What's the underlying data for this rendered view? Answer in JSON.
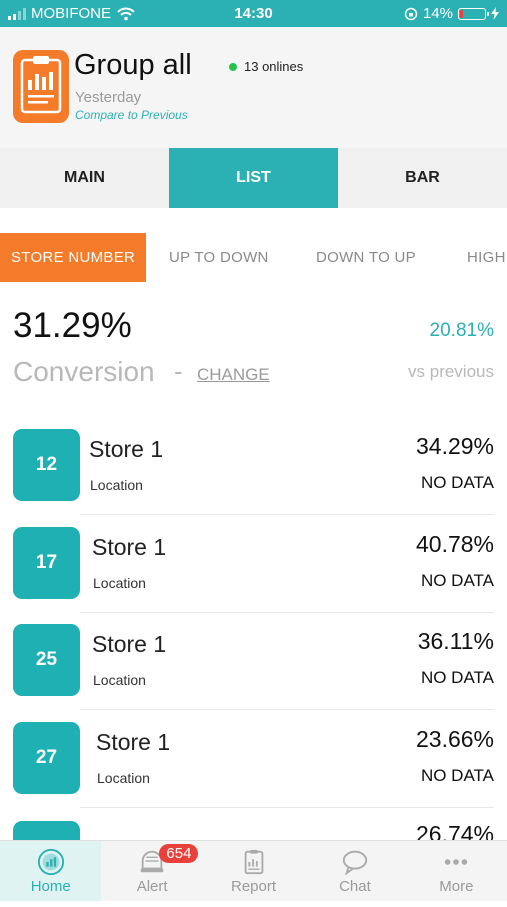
{
  "status_bar": {
    "carrier": "MOBIFONE",
    "time": "14:30",
    "battery": "14%",
    "battery_level": 0.14
  },
  "header": {
    "title": "Group all",
    "online_count": "13 onlines",
    "period": "Yesterday",
    "compare_link": "Compare to Previous"
  },
  "tabs": [
    {
      "label": "MAIN"
    },
    {
      "label": "LIST"
    },
    {
      "label": "BAR"
    }
  ],
  "sort_options": [
    {
      "label": "STORE NUMBER"
    },
    {
      "label": "UP TO DOWN"
    },
    {
      "label": "DOWN TO UP"
    },
    {
      "label": "HIGH"
    }
  ],
  "summary": {
    "value": "31.29%",
    "metric": "Conversion",
    "dash": "-",
    "change_label": "CHANGE",
    "compare_value": "20.81%",
    "compare_label": "vs previous"
  },
  "stores": [
    {
      "number": "12",
      "name": "Store 1",
      "location": "Location",
      "value": "34.29%",
      "status": "NO DATA"
    },
    {
      "number": "17",
      "name": "Store 1",
      "location": "Location",
      "value": "40.78%",
      "status": "NO DATA"
    },
    {
      "number": "25",
      "name": "Store 1",
      "location": "Location",
      "value": "36.11%",
      "status": "NO DATA"
    },
    {
      "number": "27",
      "name": "Store 1",
      "location": "Location",
      "value": "23.66%",
      "status": "NO DATA"
    },
    {
      "number": "",
      "name": "",
      "location": "",
      "value": "26.74%",
      "status": ""
    }
  ],
  "bottom_nav": [
    {
      "label": "Home",
      "icon": "home-icon"
    },
    {
      "label": "Alert",
      "icon": "alert-icon",
      "badge": "654"
    },
    {
      "label": "Report",
      "icon": "report-icon"
    },
    {
      "label": "Chat",
      "icon": "chat-icon"
    },
    {
      "label": "More",
      "icon": "more-icon"
    }
  ],
  "colors": {
    "accent": "#2bb0b4",
    "orange": "#f47b2a",
    "badge_red": "#e8413c",
    "online_green": "#27c24c"
  }
}
